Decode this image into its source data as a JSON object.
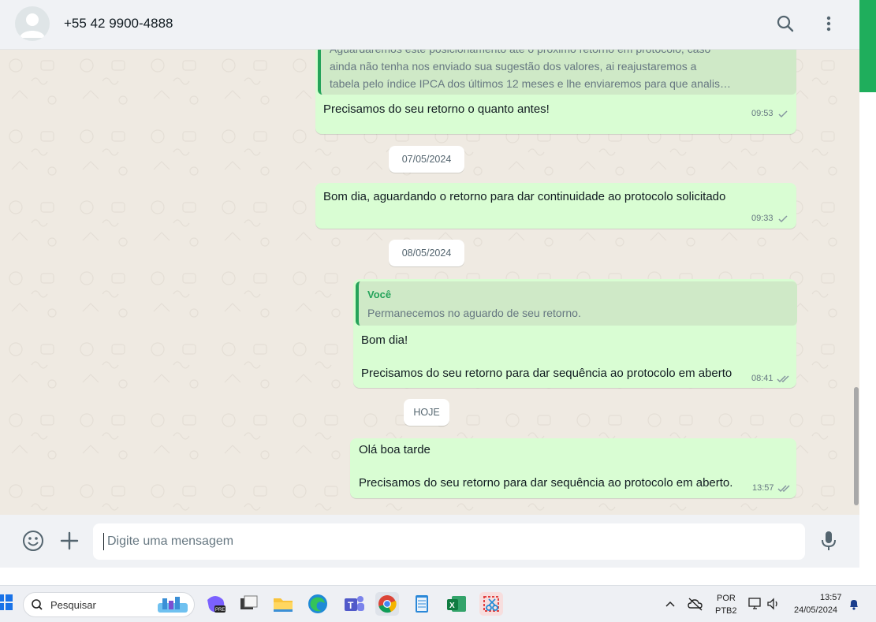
{
  "header": {
    "contact_name": "+55 42 9900-4888",
    "icons": [
      "default-avatar-icon",
      "search-icon",
      "more-options-icon"
    ]
  },
  "messages": {
    "msg1": {
      "quote_lines": [
        "Aguardaremos este posicionamento até o próximo retorno em protocolo, caso",
        "ainda não tenha nos enviado sua sugestão dos valores, ai reajustaremos a",
        "tabela pelo índice IPCA dos últimos 12 meses e lhe enviaremos para que analis…"
      ],
      "text": "Precisamos do seu retorno o quanto antes!",
      "time": "09:53",
      "status": "sent"
    },
    "date1": "07/05/2024",
    "msg2": {
      "text": "Bom dia, aguardando o retorno para dar continuidade ao protocolo solicitado",
      "time": "09:33",
      "status": "sent"
    },
    "date2": "08/05/2024",
    "msg3": {
      "quote_author": "Você",
      "quote_text": "Permanecemos no aguardo de seu retorno.",
      "line1": "Bom dia!",
      "line2": "Precisamos do seu retorno para dar sequência ao protocolo em aberto",
      "time": "08:41",
      "status": "delivered"
    },
    "date3": "HOJE",
    "msg4": {
      "line1": "Olá boa tarde",
      "line2": "Precisamos do seu retorno para dar sequência ao protocolo em aberto.",
      "time": "13:57",
      "status": "delivered"
    }
  },
  "composer": {
    "placeholder": "Digite uma mensagem",
    "icons": [
      "emoji-icon",
      "attach-plus-icon",
      "microphone-icon"
    ]
  },
  "taskbar": {
    "search_label": "Pesquisar",
    "apps": [
      "windows-start-icon",
      "copilot-icon",
      "task-view-icon",
      "file-explorer-icon",
      "edge-icon",
      "teams-icon",
      "chrome-icon",
      "notepad-icon",
      "excel-icon",
      "snipping-tool-icon"
    ],
    "language_line1": "POR",
    "language_line2": "PTB2",
    "time": "13:57",
    "date": "24/05/2024"
  },
  "colors": {
    "outgoing_bubble": "#d9fdd3",
    "chat_background": "#efeae2",
    "accent_green": "#25a35a",
    "header_background": "#f0f2f5"
  }
}
